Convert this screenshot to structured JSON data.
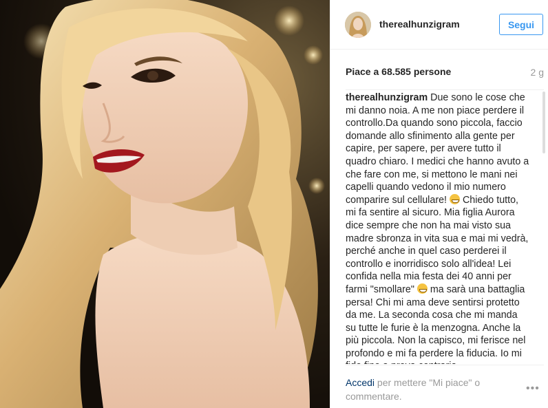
{
  "post": {
    "username": "therealhunzigram",
    "follow_label": "Segui",
    "likes": "Piace a 68.585 persone",
    "time_ago": "2 g",
    "caption_user": "therealhunzigram",
    "caption_parts": [
      " Due sono le cose che mi danno noia. A me non piace perdere il controllo.Da quando sono piccola, faccio domande allo sfinimento alla gente per capire, per sapere, per avere tutto il quadro chiaro. I medici che hanno avuto a che fare con me, si mettono le mani nei capelli quando vedono il mio numero comparire sul cellulare! ",
      " Chiedo tutto, mi fa sentire al sicuro. Mia figlia Aurora dice sempre che non ha mai visto sua madre sbronza in vita sua e mai mi vedrà, perché anche in quel caso perderei il controllo e inorridisco solo all'idea! Lei confida nella mia festa dei 40 anni per farmi \"smollare\" ",
      " ma sarà una battaglia persa! Chi mi ama deve sentirsi protetto da me. La seconda cosa che mi manda su tutte le furie è la menzogna. Anche la più piccola. Non la capisco, mi ferisce nel profondo e mi fa perdere la fiducia. Io mi fido fino a prova contraria,"
    ],
    "emoji_icon": "grinning-squinting-face"
  },
  "footer": {
    "login_link": "Accedi",
    "login_text": " per mettere \"Mi piace\" o commentare.",
    "more_label": "•••"
  }
}
